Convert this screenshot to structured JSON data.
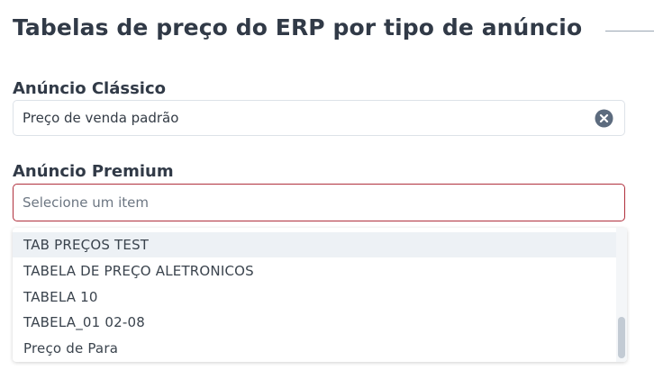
{
  "section": {
    "title": "Tabelas de preço do ERP por tipo de anúncio"
  },
  "classic": {
    "label": "Anúncio Clássico",
    "value": "Preço de venda padrão"
  },
  "premium": {
    "label": "Anúncio Premium",
    "placeholder": "Selecione um item"
  },
  "dropdown": {
    "options": [
      "TAB PREÇOS TEST",
      "TABELA DE PREÇO ALETRONICOS",
      "TABELA 10",
      "TABELA_01 02-08",
      "Preço de Para"
    ],
    "highlighted_index": 0
  },
  "icons": {
    "clear": "close-circle-icon"
  },
  "colors": {
    "error_border": "#b0303d",
    "clear_icon": "#5c6b7e"
  }
}
